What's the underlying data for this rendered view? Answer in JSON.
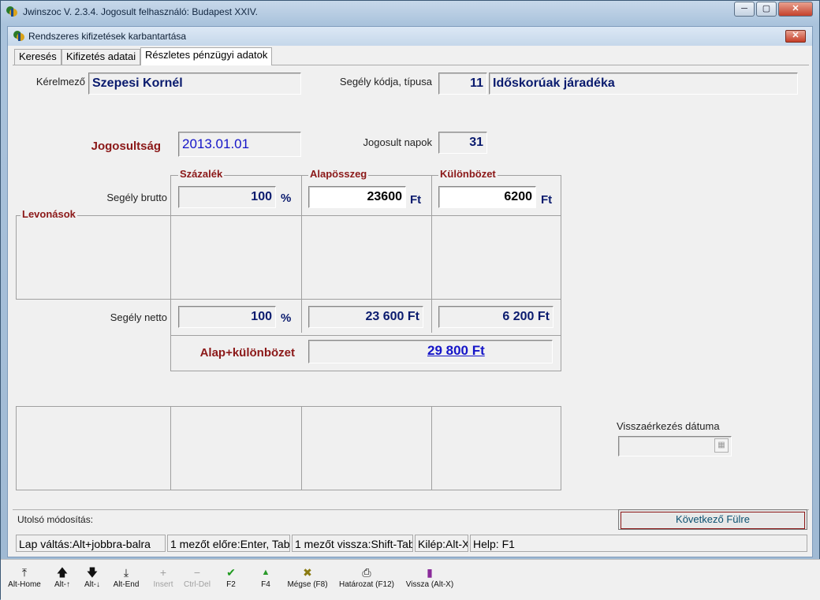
{
  "app": {
    "title": "Jwinszoc V. 2.3.4.  Jogosult felhasználó: Budapest XXIV.",
    "window_buttons": [
      "─",
      "▢",
      "✕"
    ]
  },
  "form": {
    "title": "Rendszeres kifizetések karbantartása",
    "close": "✕"
  },
  "tabs": [
    {
      "label": "Keresés"
    },
    {
      "label": "Kifizetés adatai"
    },
    {
      "label": "Részletes pénzügyi adatok",
      "active": true
    }
  ],
  "details": {
    "kerelmezo_label": "Kérelmező",
    "kerelmezo_value": "Szepesi Kornél",
    "segely_kod_label": "Segély kódja, típusa",
    "segely_kod_value": "11",
    "segely_tipus_value": "Időskorúak járadéka",
    "jogosultsag_label": "Jogosultság",
    "jogosultsag_value": "2013.01.01",
    "jogosult_napok_label": "Jogosult napok",
    "jogosult_napok_value": "31"
  },
  "grid": {
    "col_szazalek": "Százalék",
    "col_alaposszeg": "Alapösszeg",
    "col_kulonbozet": "Különbözet",
    "brutto_label": "Segély brutto",
    "brutto_percent": "100",
    "brutto_alap": "23600",
    "brutto_kulonbozet": "6200",
    "levonasok_label": "Levonások",
    "netto_label": "Segély netto",
    "netto_percent": "100",
    "netto_alap": "23 600 Ft",
    "netto_kulonbozet": "6 200 Ft",
    "osszes_label": "Alap+különbözet",
    "osszes_value": "29 800 Ft",
    "unit_percent": "%",
    "unit_ft": "Ft"
  },
  "visszaerkezes": {
    "label": "Visszaérkezés dátuma",
    "value": ""
  },
  "footer": {
    "utolso_modositas": "Utolsó módosítás:",
    "kovetkezo_button": "Következő Fülre"
  },
  "status": [
    "Lap váltás:Alt+jobbra-balra",
    "1 mezőt előre:Enter, Tab",
    "1 mezőt vissza:Shift-Tab",
    "Kilép:Alt-X",
    "Help: F1"
  ],
  "toolbar": [
    {
      "label": "Alt-Home",
      "icon": "first-record-icon",
      "glyph": "⤒",
      "enabled": true
    },
    {
      "label": "Alt-↑",
      "icon": "arrow-up-icon",
      "glyph": "🡅",
      "enabled": true
    },
    {
      "label": "Alt-↓",
      "icon": "arrow-down-icon",
      "glyph": "🡇",
      "enabled": true
    },
    {
      "label": "Alt-End",
      "icon": "last-record-icon",
      "glyph": "⤓",
      "enabled": true
    },
    {
      "label": "Insert",
      "icon": "plus-icon",
      "glyph": "+",
      "enabled": false
    },
    {
      "label": "Ctrl-Del",
      "icon": "minus-icon",
      "glyph": "−",
      "enabled": false
    },
    {
      "label": "F2",
      "icon": "check-icon",
      "glyph": "✔",
      "enabled": true
    },
    {
      "label": "F4",
      "icon": "triangle-up-icon",
      "glyph": "▲",
      "enabled": true
    },
    {
      "label": "Mégse (F8)",
      "icon": "cancel-x-icon",
      "glyph": "✖",
      "enabled": true
    },
    {
      "label": "Határozat (F12)",
      "icon": "printer-icon",
      "glyph": "⎙",
      "enabled": true
    },
    {
      "label": "Vissza (Alt-X)",
      "icon": "exit-door-icon",
      "glyph": "▮",
      "enabled": true
    }
  ],
  "colors": {
    "label_accent": "#8b1818",
    "value_text": "#0a1b6e",
    "link_blue": "#1515c8"
  }
}
